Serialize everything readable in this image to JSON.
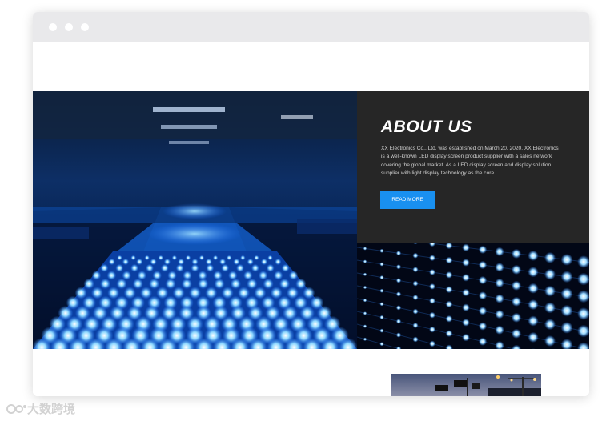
{
  "about": {
    "title": "ABOUT US",
    "description": "XX Electronics Co., Ltd. was established on March 20, 2020. XX Electronics is a well-known LED display screen product supplier with a sales network covering the global market. As a LED display screen and display solution supplier with light display technology as the core.",
    "button_label": "READ MORE"
  },
  "watermark": {
    "text": "大数跨境"
  },
  "colors": {
    "accent": "#1990f0",
    "panel": "#262626",
    "led": "#3aa0ff"
  }
}
